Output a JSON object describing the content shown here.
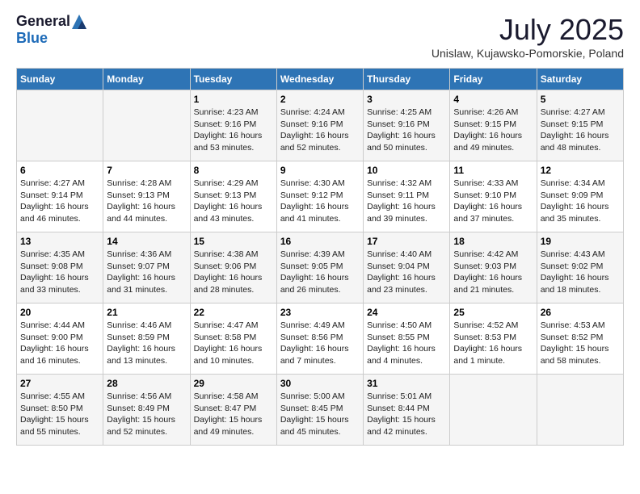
{
  "logo": {
    "general": "General",
    "blue": "Blue"
  },
  "title": "July 2025",
  "subtitle": "Unislaw, Kujawsko-Pomorskie, Poland",
  "days_of_week": [
    "Sunday",
    "Monday",
    "Tuesday",
    "Wednesday",
    "Thursday",
    "Friday",
    "Saturday"
  ],
  "weeks": [
    [
      {
        "day": "",
        "info": ""
      },
      {
        "day": "",
        "info": ""
      },
      {
        "day": "1",
        "info": "Sunrise: 4:23 AM\nSunset: 9:16 PM\nDaylight: 16 hours and 53 minutes."
      },
      {
        "day": "2",
        "info": "Sunrise: 4:24 AM\nSunset: 9:16 PM\nDaylight: 16 hours and 52 minutes."
      },
      {
        "day": "3",
        "info": "Sunrise: 4:25 AM\nSunset: 9:16 PM\nDaylight: 16 hours and 50 minutes."
      },
      {
        "day": "4",
        "info": "Sunrise: 4:26 AM\nSunset: 9:15 PM\nDaylight: 16 hours and 49 minutes."
      },
      {
        "day": "5",
        "info": "Sunrise: 4:27 AM\nSunset: 9:15 PM\nDaylight: 16 hours and 48 minutes."
      }
    ],
    [
      {
        "day": "6",
        "info": "Sunrise: 4:27 AM\nSunset: 9:14 PM\nDaylight: 16 hours and 46 minutes."
      },
      {
        "day": "7",
        "info": "Sunrise: 4:28 AM\nSunset: 9:13 PM\nDaylight: 16 hours and 44 minutes."
      },
      {
        "day": "8",
        "info": "Sunrise: 4:29 AM\nSunset: 9:13 PM\nDaylight: 16 hours and 43 minutes."
      },
      {
        "day": "9",
        "info": "Sunrise: 4:30 AM\nSunset: 9:12 PM\nDaylight: 16 hours and 41 minutes."
      },
      {
        "day": "10",
        "info": "Sunrise: 4:32 AM\nSunset: 9:11 PM\nDaylight: 16 hours and 39 minutes."
      },
      {
        "day": "11",
        "info": "Sunrise: 4:33 AM\nSunset: 9:10 PM\nDaylight: 16 hours and 37 minutes."
      },
      {
        "day": "12",
        "info": "Sunrise: 4:34 AM\nSunset: 9:09 PM\nDaylight: 16 hours and 35 minutes."
      }
    ],
    [
      {
        "day": "13",
        "info": "Sunrise: 4:35 AM\nSunset: 9:08 PM\nDaylight: 16 hours and 33 minutes."
      },
      {
        "day": "14",
        "info": "Sunrise: 4:36 AM\nSunset: 9:07 PM\nDaylight: 16 hours and 31 minutes."
      },
      {
        "day": "15",
        "info": "Sunrise: 4:38 AM\nSunset: 9:06 PM\nDaylight: 16 hours and 28 minutes."
      },
      {
        "day": "16",
        "info": "Sunrise: 4:39 AM\nSunset: 9:05 PM\nDaylight: 16 hours and 26 minutes."
      },
      {
        "day": "17",
        "info": "Sunrise: 4:40 AM\nSunset: 9:04 PM\nDaylight: 16 hours and 23 minutes."
      },
      {
        "day": "18",
        "info": "Sunrise: 4:42 AM\nSunset: 9:03 PM\nDaylight: 16 hours and 21 minutes."
      },
      {
        "day": "19",
        "info": "Sunrise: 4:43 AM\nSunset: 9:02 PM\nDaylight: 16 hours and 18 minutes."
      }
    ],
    [
      {
        "day": "20",
        "info": "Sunrise: 4:44 AM\nSunset: 9:00 PM\nDaylight: 16 hours and 16 minutes."
      },
      {
        "day": "21",
        "info": "Sunrise: 4:46 AM\nSunset: 8:59 PM\nDaylight: 16 hours and 13 minutes."
      },
      {
        "day": "22",
        "info": "Sunrise: 4:47 AM\nSunset: 8:58 PM\nDaylight: 16 hours and 10 minutes."
      },
      {
        "day": "23",
        "info": "Sunrise: 4:49 AM\nSunset: 8:56 PM\nDaylight: 16 hours and 7 minutes."
      },
      {
        "day": "24",
        "info": "Sunrise: 4:50 AM\nSunset: 8:55 PM\nDaylight: 16 hours and 4 minutes."
      },
      {
        "day": "25",
        "info": "Sunrise: 4:52 AM\nSunset: 8:53 PM\nDaylight: 16 hours and 1 minute."
      },
      {
        "day": "26",
        "info": "Sunrise: 4:53 AM\nSunset: 8:52 PM\nDaylight: 15 hours and 58 minutes."
      }
    ],
    [
      {
        "day": "27",
        "info": "Sunrise: 4:55 AM\nSunset: 8:50 PM\nDaylight: 15 hours and 55 minutes."
      },
      {
        "day": "28",
        "info": "Sunrise: 4:56 AM\nSunset: 8:49 PM\nDaylight: 15 hours and 52 minutes."
      },
      {
        "day": "29",
        "info": "Sunrise: 4:58 AM\nSunset: 8:47 PM\nDaylight: 15 hours and 49 minutes."
      },
      {
        "day": "30",
        "info": "Sunrise: 5:00 AM\nSunset: 8:45 PM\nDaylight: 15 hours and 45 minutes."
      },
      {
        "day": "31",
        "info": "Sunrise: 5:01 AM\nSunset: 8:44 PM\nDaylight: 15 hours and 42 minutes."
      },
      {
        "day": "",
        "info": ""
      },
      {
        "day": "",
        "info": ""
      }
    ]
  ]
}
